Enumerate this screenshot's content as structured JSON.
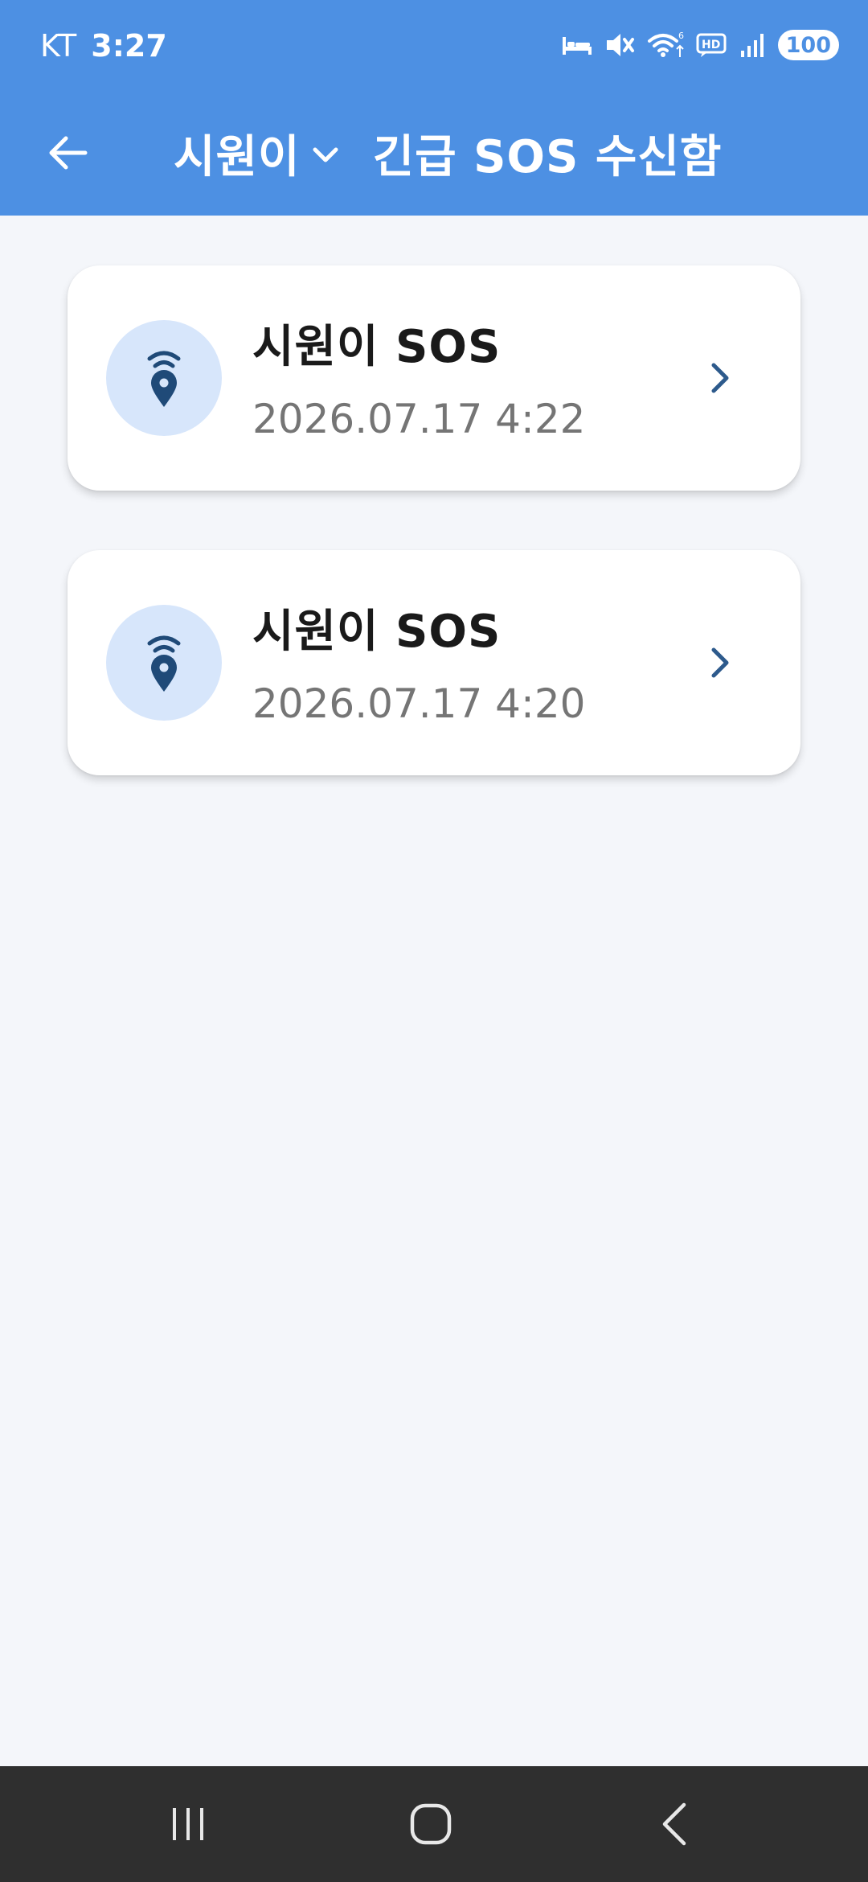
{
  "status": {
    "carrier": "KT",
    "time": "3:27",
    "battery": "100",
    "icons": [
      "bed-icon",
      "mute-icon",
      "wifi-icon",
      "hd-icon",
      "signal-icon"
    ]
  },
  "header": {
    "selector_name": "시원이",
    "title": "긴급 SOS 수신함",
    "back_icon": "arrow-left-icon",
    "dropdown_icon": "chevron-down-icon"
  },
  "items": [
    {
      "title": "시원이 SOS",
      "time": "2026.07.17 4:22",
      "icon": "location-signal-icon"
    },
    {
      "title": "시원이 SOS",
      "time": "2026.07.17 4:20",
      "icon": "location-signal-icon"
    }
  ],
  "colors": {
    "primary": "#4d90e3",
    "background": "#f4f6fa",
    "icon_circle": "#d7e6fb",
    "icon_dark": "#1f4a78",
    "navbar": "#2f2f2f"
  },
  "navbar": {
    "icons": [
      "recents-icon",
      "home-icon",
      "back-icon"
    ]
  }
}
